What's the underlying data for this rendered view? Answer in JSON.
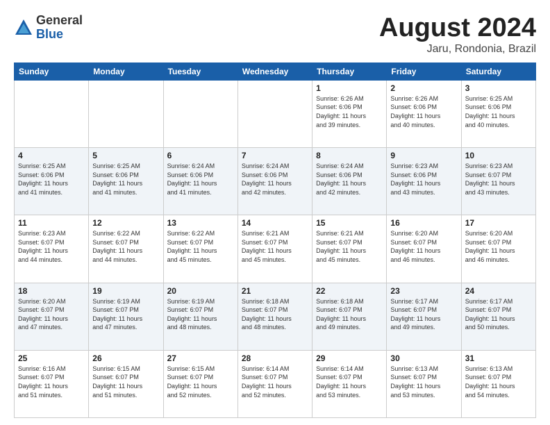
{
  "header": {
    "logo_line1": "General",
    "logo_line2": "Blue",
    "title": "August 2024",
    "subtitle": "Jaru, Rondonia, Brazil"
  },
  "weekdays": [
    "Sunday",
    "Monday",
    "Tuesday",
    "Wednesday",
    "Thursday",
    "Friday",
    "Saturday"
  ],
  "weeks": [
    [
      {
        "day": "",
        "info": ""
      },
      {
        "day": "",
        "info": ""
      },
      {
        "day": "",
        "info": ""
      },
      {
        "day": "",
        "info": ""
      },
      {
        "day": "1",
        "info": "Sunrise: 6:26 AM\nSunset: 6:06 PM\nDaylight: 11 hours\nand 39 minutes."
      },
      {
        "day": "2",
        "info": "Sunrise: 6:26 AM\nSunset: 6:06 PM\nDaylight: 11 hours\nand 40 minutes."
      },
      {
        "day": "3",
        "info": "Sunrise: 6:25 AM\nSunset: 6:06 PM\nDaylight: 11 hours\nand 40 minutes."
      }
    ],
    [
      {
        "day": "4",
        "info": "Sunrise: 6:25 AM\nSunset: 6:06 PM\nDaylight: 11 hours\nand 41 minutes."
      },
      {
        "day": "5",
        "info": "Sunrise: 6:25 AM\nSunset: 6:06 PM\nDaylight: 11 hours\nand 41 minutes."
      },
      {
        "day": "6",
        "info": "Sunrise: 6:24 AM\nSunset: 6:06 PM\nDaylight: 11 hours\nand 41 minutes."
      },
      {
        "day": "7",
        "info": "Sunrise: 6:24 AM\nSunset: 6:06 PM\nDaylight: 11 hours\nand 42 minutes."
      },
      {
        "day": "8",
        "info": "Sunrise: 6:24 AM\nSunset: 6:06 PM\nDaylight: 11 hours\nand 42 minutes."
      },
      {
        "day": "9",
        "info": "Sunrise: 6:23 AM\nSunset: 6:06 PM\nDaylight: 11 hours\nand 43 minutes."
      },
      {
        "day": "10",
        "info": "Sunrise: 6:23 AM\nSunset: 6:07 PM\nDaylight: 11 hours\nand 43 minutes."
      }
    ],
    [
      {
        "day": "11",
        "info": "Sunrise: 6:23 AM\nSunset: 6:07 PM\nDaylight: 11 hours\nand 44 minutes."
      },
      {
        "day": "12",
        "info": "Sunrise: 6:22 AM\nSunset: 6:07 PM\nDaylight: 11 hours\nand 44 minutes."
      },
      {
        "day": "13",
        "info": "Sunrise: 6:22 AM\nSunset: 6:07 PM\nDaylight: 11 hours\nand 45 minutes."
      },
      {
        "day": "14",
        "info": "Sunrise: 6:21 AM\nSunset: 6:07 PM\nDaylight: 11 hours\nand 45 minutes."
      },
      {
        "day": "15",
        "info": "Sunrise: 6:21 AM\nSunset: 6:07 PM\nDaylight: 11 hours\nand 45 minutes."
      },
      {
        "day": "16",
        "info": "Sunrise: 6:20 AM\nSunset: 6:07 PM\nDaylight: 11 hours\nand 46 minutes."
      },
      {
        "day": "17",
        "info": "Sunrise: 6:20 AM\nSunset: 6:07 PM\nDaylight: 11 hours\nand 46 minutes."
      }
    ],
    [
      {
        "day": "18",
        "info": "Sunrise: 6:20 AM\nSunset: 6:07 PM\nDaylight: 11 hours\nand 47 minutes."
      },
      {
        "day": "19",
        "info": "Sunrise: 6:19 AM\nSunset: 6:07 PM\nDaylight: 11 hours\nand 47 minutes."
      },
      {
        "day": "20",
        "info": "Sunrise: 6:19 AM\nSunset: 6:07 PM\nDaylight: 11 hours\nand 48 minutes."
      },
      {
        "day": "21",
        "info": "Sunrise: 6:18 AM\nSunset: 6:07 PM\nDaylight: 11 hours\nand 48 minutes."
      },
      {
        "day": "22",
        "info": "Sunrise: 6:18 AM\nSunset: 6:07 PM\nDaylight: 11 hours\nand 49 minutes."
      },
      {
        "day": "23",
        "info": "Sunrise: 6:17 AM\nSunset: 6:07 PM\nDaylight: 11 hours\nand 49 minutes."
      },
      {
        "day": "24",
        "info": "Sunrise: 6:17 AM\nSunset: 6:07 PM\nDaylight: 11 hours\nand 50 minutes."
      }
    ],
    [
      {
        "day": "25",
        "info": "Sunrise: 6:16 AM\nSunset: 6:07 PM\nDaylight: 11 hours\nand 51 minutes."
      },
      {
        "day": "26",
        "info": "Sunrise: 6:15 AM\nSunset: 6:07 PM\nDaylight: 11 hours\nand 51 minutes."
      },
      {
        "day": "27",
        "info": "Sunrise: 6:15 AM\nSunset: 6:07 PM\nDaylight: 11 hours\nand 52 minutes."
      },
      {
        "day": "28",
        "info": "Sunrise: 6:14 AM\nSunset: 6:07 PM\nDaylight: 11 hours\nand 52 minutes."
      },
      {
        "day": "29",
        "info": "Sunrise: 6:14 AM\nSunset: 6:07 PM\nDaylight: 11 hours\nand 53 minutes."
      },
      {
        "day": "30",
        "info": "Sunrise: 6:13 AM\nSunset: 6:07 PM\nDaylight: 11 hours\nand 53 minutes."
      },
      {
        "day": "31",
        "info": "Sunrise: 6:13 AM\nSunset: 6:07 PM\nDaylight: 11 hours\nand 54 minutes."
      }
    ]
  ]
}
